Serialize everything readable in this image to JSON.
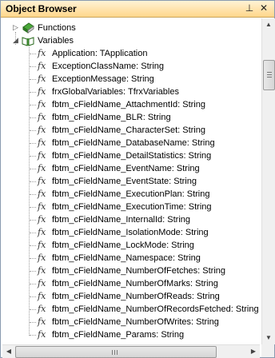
{
  "window": {
    "title": "Object Browser",
    "pin_glyph": "⊥",
    "close_glyph": "✕"
  },
  "colors": {
    "titlebar_top": "#fff3d6",
    "titlebar_bottom": "#ffd68a",
    "folder_green": "#3c8a2e"
  },
  "tree": {
    "groups": [
      {
        "label": "Functions",
        "expanded": false,
        "icon": "green-book-icon"
      },
      {
        "label": "Variables",
        "expanded": true,
        "icon": "open-book-icon"
      }
    ],
    "variables": [
      "Application: TApplication",
      "ExceptionClassName: String",
      "ExceptionMessage: String",
      "frxGlobalVariables: TfrxVariables",
      "fbtm_cFieldName_AttachmentId: String",
      "fbtm_cFieldName_BLR: String",
      "fbtm_cFieldName_CharacterSet: String",
      "fbtm_cFieldName_DatabaseName: String",
      "fbtm_cFieldName_DetailStatistics: String",
      "fbtm_cFieldName_EventName: String",
      "fbtm_cFieldName_EventState: String",
      "fbtm_cFieldName_ExecutionPlan: String",
      "fbtm_cFieldName_ExecutionTime: String",
      "fbtm_cFieldName_InternalId: String",
      "fbtm_cFieldName_IsolationMode: String",
      "fbtm_cFieldName_LockMode: String",
      "fbtm_cFieldName_Namespace: String",
      "fbtm_cFieldName_NumberOfFetches: String",
      "fbtm_cFieldName_NumberOfMarks: String",
      "fbtm_cFieldName_NumberOfReads: String",
      "fbtm_cFieldName_NumberOfRecordsFetched: String",
      "fbtm_cFieldName_NumberOfWrites: String",
      "fbtm_cFieldName_Params: String"
    ]
  },
  "scrollbars": {
    "up_glyph": "▲",
    "down_glyph": "▼",
    "left_glyph": "◀",
    "right_glyph": "▶"
  }
}
